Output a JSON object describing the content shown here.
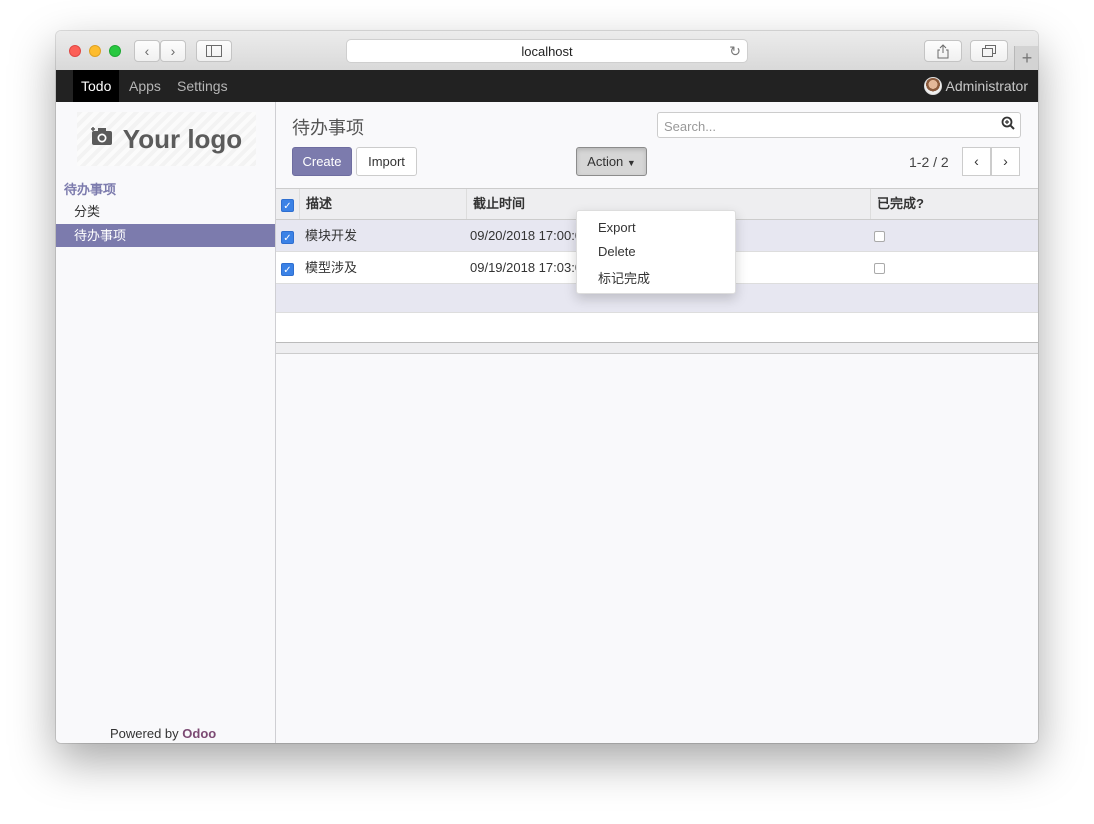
{
  "browser": {
    "address": "localhost"
  },
  "navbar": {
    "apps": [
      "Todo",
      "Apps",
      "Settings"
    ],
    "user": "Administrator"
  },
  "sidebar": {
    "logo_text": "Your logo",
    "section": "待办事项",
    "items": [
      {
        "label": "分类",
        "active": false
      },
      {
        "label": "待办事项",
        "active": true
      }
    ],
    "powered_prefix": "Powered by",
    "powered_brand": "Odoo"
  },
  "main": {
    "title": "待办事项",
    "search_placeholder": "Search...",
    "create_label": "Create",
    "import_label": "Import",
    "action_label": "Action",
    "pager": "1-2 / 2",
    "action_menu": [
      "Export",
      "Delete",
      "标记完成"
    ],
    "columns": [
      "描述",
      "截止时间",
      "已完成?"
    ],
    "rows": [
      {
        "desc": "模块开发",
        "deadline": "09/20/2018 17:00:00",
        "done": false,
        "selected": true
      },
      {
        "desc": "模型涉及",
        "deadline": "09/19/2018 17:03:04",
        "done": false,
        "selected": true
      }
    ]
  },
  "colors": {
    "brand": "#7c7bad",
    "navbar": "#222222",
    "checkbox": "#3b82e6"
  }
}
